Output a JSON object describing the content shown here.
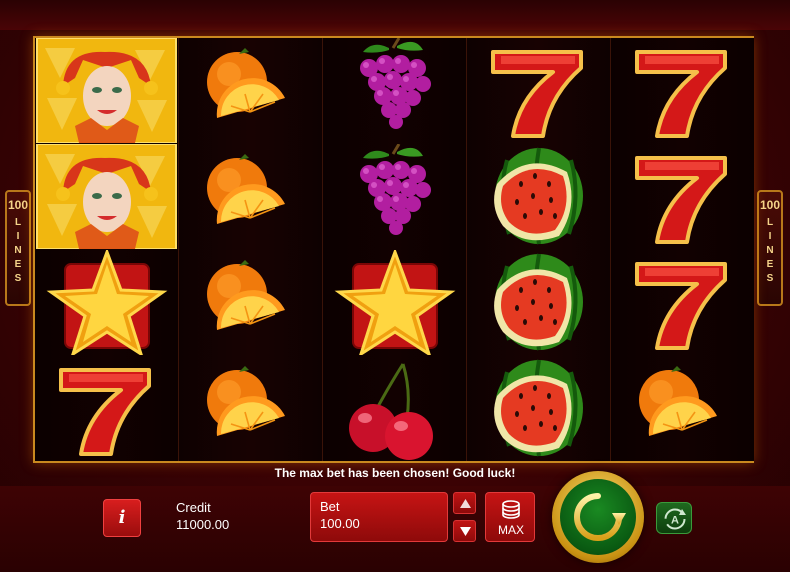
{
  "paylines": {
    "count": "100",
    "word": "LINES"
  },
  "reels": [
    [
      "joker",
      "joker",
      "star",
      "seven"
    ],
    [
      "orange",
      "orange",
      "orange",
      "orange"
    ],
    [
      "grapes",
      "grapes",
      "star",
      "cherries"
    ],
    [
      "seven",
      "watermelon",
      "watermelon",
      "watermelon"
    ],
    [
      "seven",
      "seven",
      "seven",
      "orange"
    ]
  ],
  "message": "The max bet has been chosen! Good luck!",
  "credit": {
    "label": "Credit",
    "value": "11000.00"
  },
  "bet": {
    "label": "Bet",
    "value": "100.00"
  },
  "max_button": {
    "label": "MAX"
  },
  "info_button": {
    "label": "i"
  },
  "icons": {
    "info": "info-icon",
    "increase": "triangle-up-icon",
    "decrease": "triangle-down-icon",
    "coins": "coin-stack-icon",
    "spin": "spin-arrow-icon",
    "autoplay": "autoplay-icon"
  },
  "colors": {
    "frame_gold": "#c9891f",
    "button_red": "#c61414",
    "spin_green": "#0a5a12"
  }
}
